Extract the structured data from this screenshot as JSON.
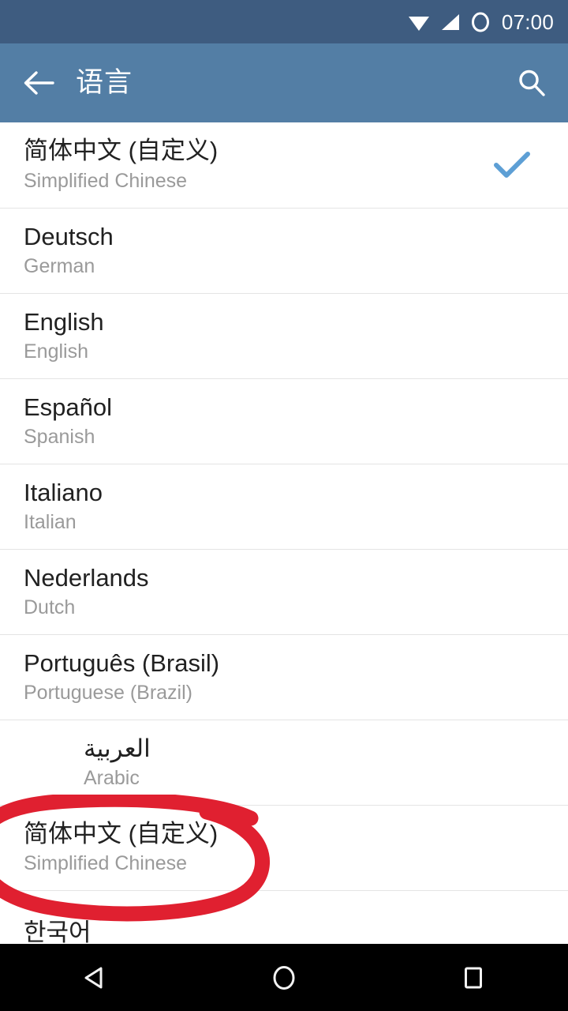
{
  "status_bar": {
    "time": "07:00",
    "background": "#3e5c80",
    "icons": [
      {
        "name": "wifi-icon",
        "glyph": "wifi"
      },
      {
        "name": "cellular-signal-icon",
        "glyph": "signal"
      },
      {
        "name": "battery-empty-icon",
        "glyph": "circle"
      }
    ]
  },
  "app_bar": {
    "title": "语言",
    "background": "#537ea5",
    "back_icon": "arrow-left-icon",
    "search_icon": "search-icon"
  },
  "colors": {
    "accent_check": "#5d9fd5",
    "primary_text": "#212121",
    "secondary_text": "#9a9a9a",
    "divider": "#e4e4e4",
    "annotation_red": "#e02030",
    "nav_bar": "#000000"
  },
  "list": {
    "items": [
      {
        "native": "简体中文 (自定义)",
        "english": "Simplified Chinese",
        "selected": true,
        "rtl": false,
        "annotated": false
      },
      {
        "native": "Deutsch",
        "english": "German",
        "selected": false,
        "rtl": false,
        "annotated": false
      },
      {
        "native": "English",
        "english": "English",
        "selected": false,
        "rtl": false,
        "annotated": false
      },
      {
        "native": "Español",
        "english": "Spanish",
        "selected": false,
        "rtl": false,
        "annotated": false
      },
      {
        "native": "Italiano",
        "english": "Italian",
        "selected": false,
        "rtl": false,
        "annotated": false
      },
      {
        "native": "Nederlands",
        "english": "Dutch",
        "selected": false,
        "rtl": false,
        "annotated": false
      },
      {
        "native": "Português (Brasil)",
        "english": "Portuguese (Brazil)",
        "selected": false,
        "rtl": false,
        "annotated": false
      },
      {
        "native": "العربية",
        "english": "Arabic",
        "selected": false,
        "rtl": true,
        "annotated": false
      },
      {
        "native": "简体中文 (自定义)",
        "english": "Simplified Chinese",
        "selected": false,
        "rtl": false,
        "annotated": true
      },
      {
        "native": "한국어",
        "english": "",
        "selected": false,
        "rtl": false,
        "annotated": false
      }
    ]
  },
  "annotation": {
    "shape": "hand-drawn-red-ellipse",
    "targets_item_index": 8,
    "color": "#e02030"
  },
  "nav_bar": {
    "buttons": [
      {
        "name": "nav-back-button",
        "icon": "triangle-left-icon"
      },
      {
        "name": "nav-home-button",
        "icon": "circle-icon"
      },
      {
        "name": "nav-recents-button",
        "icon": "square-icon"
      }
    ]
  }
}
